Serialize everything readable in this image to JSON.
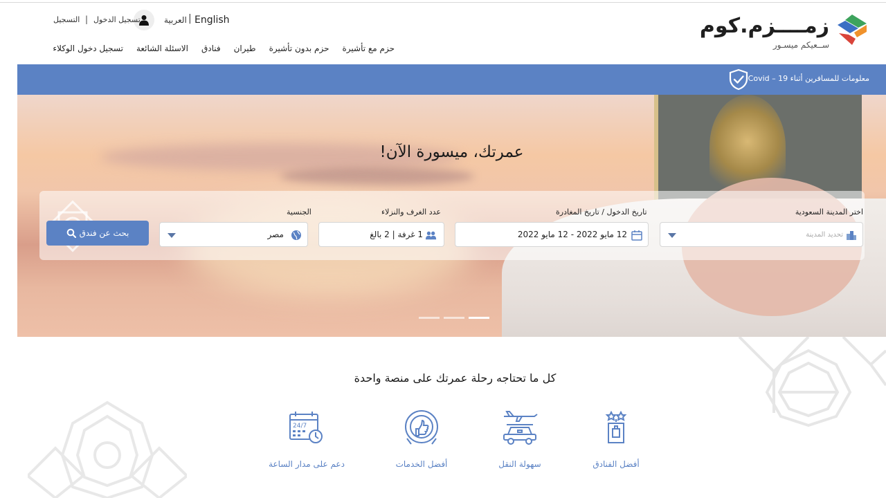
{
  "header": {
    "lang_en": "English",
    "lang_ar": "العربية",
    "login": "تسجيل الدخول",
    "register": "التسجيل",
    "nav": [
      {
        "label": "حزم مع تأشيرة"
      },
      {
        "label": "حزم بدون تأشيرة"
      },
      {
        "label": "طيران"
      },
      {
        "label": "فنادق"
      },
      {
        "label": "الاسئلة الشائعة"
      },
      {
        "label": "تسجيل دخول الوكلاء"
      }
    ]
  },
  "logo": {
    "text": "زمــــزم.كوم",
    "tagline": "ســعيكم ميسـور"
  },
  "covid": {
    "text": "معلومات للمسافرين أثناء 19 – Covid",
    "icon": "shield-check-icon"
  },
  "hero": {
    "title": "عمرتك، ميسورة الآن!"
  },
  "search": {
    "city_label": "اختر المدينة السعودية",
    "city_placeholder": "تحديد المدينة",
    "dates_label": "تاريخ الدخول / تاريخ المغادرة",
    "dates_value": "12 مايو 2022 - 12 مايو 2022",
    "rooms_label": "عدد الغرف والنزلاء",
    "rooms_value": "1 غرفة | 2 بالغ",
    "nationality_label": "الجنسية",
    "nationality_value": "مصر",
    "button": "بحث عن فندق"
  },
  "features": {
    "title": "كل ما تحتاجه رحلة عمرتك على منصة واحدة",
    "items": [
      {
        "label": "دعم على مدار الساعة",
        "icon": "support-247-calendar-icon"
      },
      {
        "label": "أفضل الخدمات",
        "icon": "thumbs-up-badge-icon"
      },
      {
        "label": "سهولة النقل",
        "icon": "plane-car-icon"
      },
      {
        "label": "أفضل الفنادق",
        "icon": "hotel-luggage-icon"
      }
    ]
  },
  "colors": {
    "accent": "#5b82c4",
    "logo_green": "#3da35d",
    "logo_orange": "#f0922c",
    "logo_red": "#d9443a",
    "logo_blue": "#3b6fc4"
  }
}
